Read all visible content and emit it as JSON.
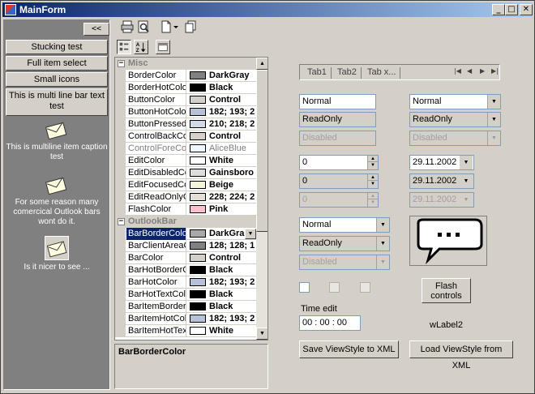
{
  "window": {
    "title": "MainForm",
    "min": "_",
    "max": "□",
    "close": "✕"
  },
  "leftbar": {
    "collapse_label": "<<",
    "items": [
      "Stucking test",
      "Full item select",
      "Small icons",
      "This is multi line bar text test"
    ],
    "outlook_items": [
      "This is multiline item caption test",
      "For some reason many comercical Outlook bars wont do it.",
      "Is it nicer to see ..."
    ]
  },
  "propgrid": {
    "cat_misc": "Misc",
    "cat_outlookbar": "OutlookBar",
    "misc_rows": [
      {
        "name": "BorderColor",
        "color": "#808080",
        "value": "DarkGray"
      },
      {
        "name": "BorderHotColor",
        "color": "#000000",
        "value": "Black"
      },
      {
        "name": "ButtonColor",
        "color": "#d4d0c8",
        "value": "Control"
      },
      {
        "name": "ButtonHotColor",
        "color": "#b6c1d8",
        "value": "182; 193; 2"
      },
      {
        "name": "ButtonPressedC",
        "color": "#d2dae6",
        "value": "210; 218; 2"
      },
      {
        "name": "ControlBackCol",
        "color": "#d4d0c8",
        "value": "Control"
      },
      {
        "name": "ControlForeColo",
        "color": "#f0f8ff",
        "value": "AliceBlue"
      },
      {
        "name": "EditColor",
        "color": "#ffffff",
        "value": "White"
      },
      {
        "name": "EditDisabledCo",
        "color": "#dcdcdc",
        "value": "Gainsboro"
      },
      {
        "name": "EditFocusedCo",
        "color": "#f5f5dc",
        "value": "Beige"
      },
      {
        "name": "EditReadOnlyC",
        "color": "#e4e0d8",
        "value": "228; 224; 2"
      },
      {
        "name": "FlashColor",
        "color": "#ffc0cb",
        "value": "Pink"
      }
    ],
    "outlook_rows": [
      {
        "name": "BarBorderColor",
        "color": "#a9a9a9",
        "value": "DarkGra"
      },
      {
        "name": "BarClientAreaC",
        "color": "#808080",
        "value": "128; 128; 1"
      },
      {
        "name": "BarColor",
        "color": "#d4d0c8",
        "value": "Control"
      },
      {
        "name": "BarHotBorderC",
        "color": "#000000",
        "value": "Black"
      },
      {
        "name": "BarHotColor",
        "color": "#b6c1d8",
        "value": "182; 193; 2"
      },
      {
        "name": "BarHotTextColo",
        "color": "#000000",
        "value": "Black"
      },
      {
        "name": "BarItemBorderH",
        "color": "#000000",
        "value": "Black"
      },
      {
        "name": "BarItemHotColo",
        "color": "#b6c1d8",
        "value": "182; 193; 2"
      },
      {
        "name": "BarItemHotText",
        "color": "#ffffff",
        "value": "White"
      }
    ],
    "description": "BarBorderColor"
  },
  "tabs": {
    "items": [
      "Tab1",
      "Tab2",
      "Tab x..."
    ]
  },
  "fields": {
    "text_normal": "Normal",
    "text_readonly": "ReadOnly",
    "text_disabled": "Disabled",
    "combo_normal": "Normal",
    "combo_readonly": "ReadOnly",
    "combo_disabled": "Disabled",
    "num1": "0",
    "num2": "0",
    "num3": "0",
    "date1": "29.11.2002",
    "date2": "29.11.2002",
    "date3": "29.11.2002",
    "combo2_normal": "Normal",
    "combo2_readonly": "ReadOnly",
    "combo2_disabled": "Disabled"
  },
  "flash_label": "Flash controls",
  "time_edit_label": "Time edit",
  "time_value": "00 : 00 : 00",
  "wlabel": "wLabel2",
  "save_label": "Save ViewStyle to XML",
  "load_label": "Load ViewStyle from XML"
}
